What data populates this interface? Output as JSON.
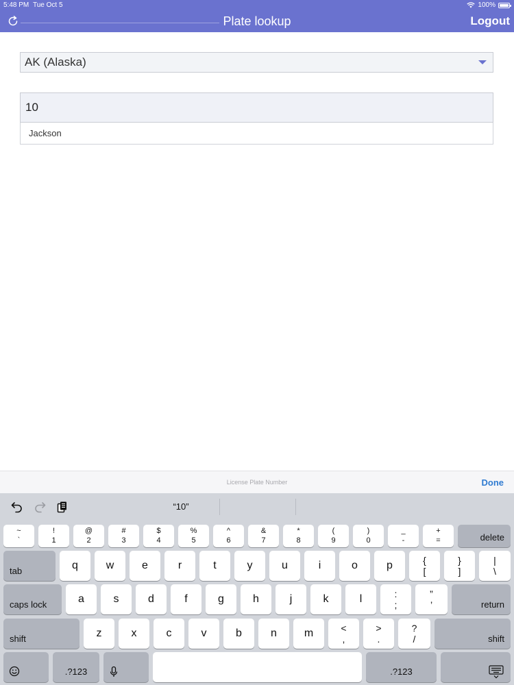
{
  "status": {
    "time": "5:48 PM",
    "date": "Tue Oct 5",
    "battery": "100%"
  },
  "header": {
    "title": "Plate lookup",
    "logout_label": "Logout",
    "refresh_icon": "refresh-icon"
  },
  "form": {
    "state_select": {
      "value": "AK (Alaska)"
    },
    "plate_input": {
      "value": "10",
      "suggestion": "Jackson"
    }
  },
  "accessory": {
    "placeholder": "License Plate Number",
    "done_label": "Done"
  },
  "keyboard": {
    "prediction": "“10”",
    "number_row": [
      {
        "top": "~",
        "bot": "`"
      },
      {
        "top": "!",
        "bot": "1"
      },
      {
        "top": "@",
        "bot": "2"
      },
      {
        "top": "#",
        "bot": "3"
      },
      {
        "top": "$",
        "bot": "4"
      },
      {
        "top": "%",
        "bot": "5"
      },
      {
        "top": "^",
        "bot": "6"
      },
      {
        "top": "&",
        "bot": "7"
      },
      {
        "top": "*",
        "bot": "8"
      },
      {
        "top": "(",
        "bot": "9"
      },
      {
        "top": ")",
        "bot": "0"
      },
      {
        "top": "_",
        "bot": "-"
      },
      {
        "top": "+",
        "bot": "="
      }
    ],
    "delete_label": "delete",
    "tab_label": "tab",
    "qwerty_row": [
      "q",
      "w",
      "e",
      "r",
      "t",
      "y",
      "u",
      "i",
      "o",
      "p"
    ],
    "bracket_keys": [
      {
        "top": "{",
        "bot": "["
      },
      {
        "top": "}",
        "bot": "]"
      },
      {
        "top": "|",
        "bot": "\\"
      }
    ],
    "caps_label": "caps lock",
    "asdf_row": [
      "a",
      "s",
      "d",
      "f",
      "g",
      "h",
      "j",
      "k",
      "l"
    ],
    "semi_keys": [
      {
        "top": ":",
        "bot": ";"
      },
      {
        "top": "”",
        "bot": "’"
      }
    ],
    "return_label": "return",
    "shift_label": "shift",
    "zxcv_row": [
      "z",
      "x",
      "c",
      "v",
      "b",
      "n",
      "m"
    ],
    "punct_keys": [
      {
        "top": "<",
        "bot": ","
      },
      {
        "top": ">",
        "bot": "."
      },
      {
        "top": "?",
        "bot": "/"
      }
    ],
    "num_label": ".?123"
  }
}
